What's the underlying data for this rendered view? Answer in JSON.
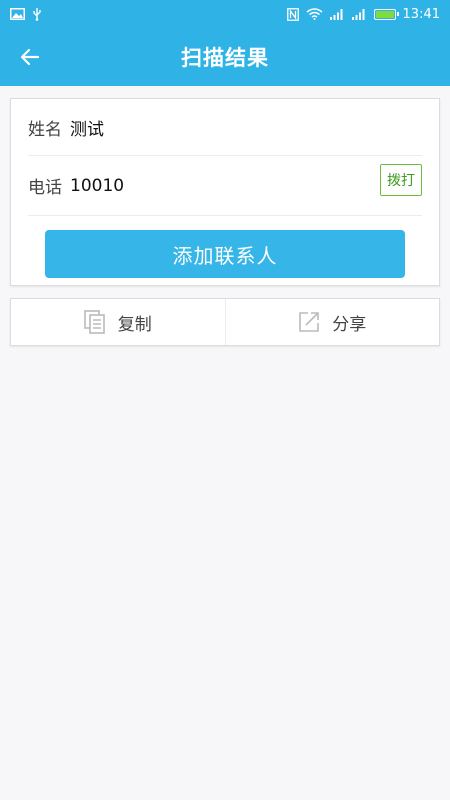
{
  "status_bar": {
    "time": "13:41",
    "icons": [
      "image-icon",
      "usb-icon",
      "nfc-icon",
      "wifi-icon",
      "signal-icon",
      "signal-icon",
      "battery-icon"
    ],
    "battery_level": 1.0,
    "accent_color": "#2fb3e6"
  },
  "app_bar": {
    "title": "扫描结果",
    "back_icon": "arrow-left-icon"
  },
  "contact": {
    "name_label": "姓名",
    "name_value": "测试",
    "phone_label": "电话",
    "phone_value": "10010",
    "dial_label": "拨打",
    "dial_color": "#6cbf3e"
  },
  "add_contact_label": "添加联系人",
  "actions": {
    "copy": {
      "label": "复制",
      "icon": "copy-icon"
    },
    "share": {
      "label": "分享",
      "icon": "share-icon"
    }
  }
}
